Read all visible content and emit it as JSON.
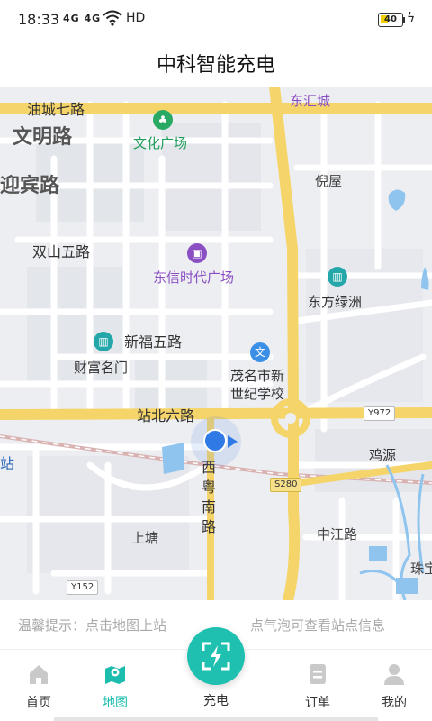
{
  "status_bar": {
    "time": "18:33",
    "signal": "4G 4G",
    "network": "HD",
    "battery": "40",
    "battery_level_percent": 40
  },
  "header": {
    "title": "中科智能充电"
  },
  "map": {
    "labels": {
      "youcheng_qilu": "油城七路",
      "donghuicheng": "东汇城",
      "wenming_lu": "文明路",
      "wenhua_guangchang": "文化广场",
      "yingbin_lu": "迎宾路",
      "niwu": "倪屋",
      "shuangshan_wulu": "双山五路",
      "dongxin_shidai": "东信时代广场",
      "dongfang_lvzhou": "东方绿洲",
      "xinfu_wulu": "新福五路",
      "caifu_mingmen": "财富名门",
      "maoming_xinshiji_1": "茂名市新",
      "maoming_xinshiji_2": "世纪学校",
      "zhanbei_liulu": "站北六路",
      "zhan": "站",
      "xiyue_nanlu": "西粤南路",
      "jiyuan": "鸡源",
      "shangtang": "上塘",
      "zhongjiang_lu": "中江路",
      "zhubao": "珠宝"
    },
    "road_signs": {
      "y972": "Y972",
      "s280": "S280",
      "y152": "Y152"
    },
    "colors": {
      "main_road": "#f5d56a",
      "minor_road": "#ffffff",
      "water": "#8fc4ee",
      "railway": "#d9b2b2",
      "location": "#2f7ae5"
    }
  },
  "tip": {
    "left": "温馨提示：点击地图上站",
    "right": "点气泡可查看站点信息"
  },
  "nav": {
    "home": "首页",
    "map": "地图",
    "charge": "充电",
    "orders": "订单",
    "mine": "我的"
  },
  "icons": {
    "home": "home-icon",
    "map": "map-icon",
    "charge": "scan-charge-icon",
    "orders": "order-icon",
    "mine": "user-icon"
  }
}
